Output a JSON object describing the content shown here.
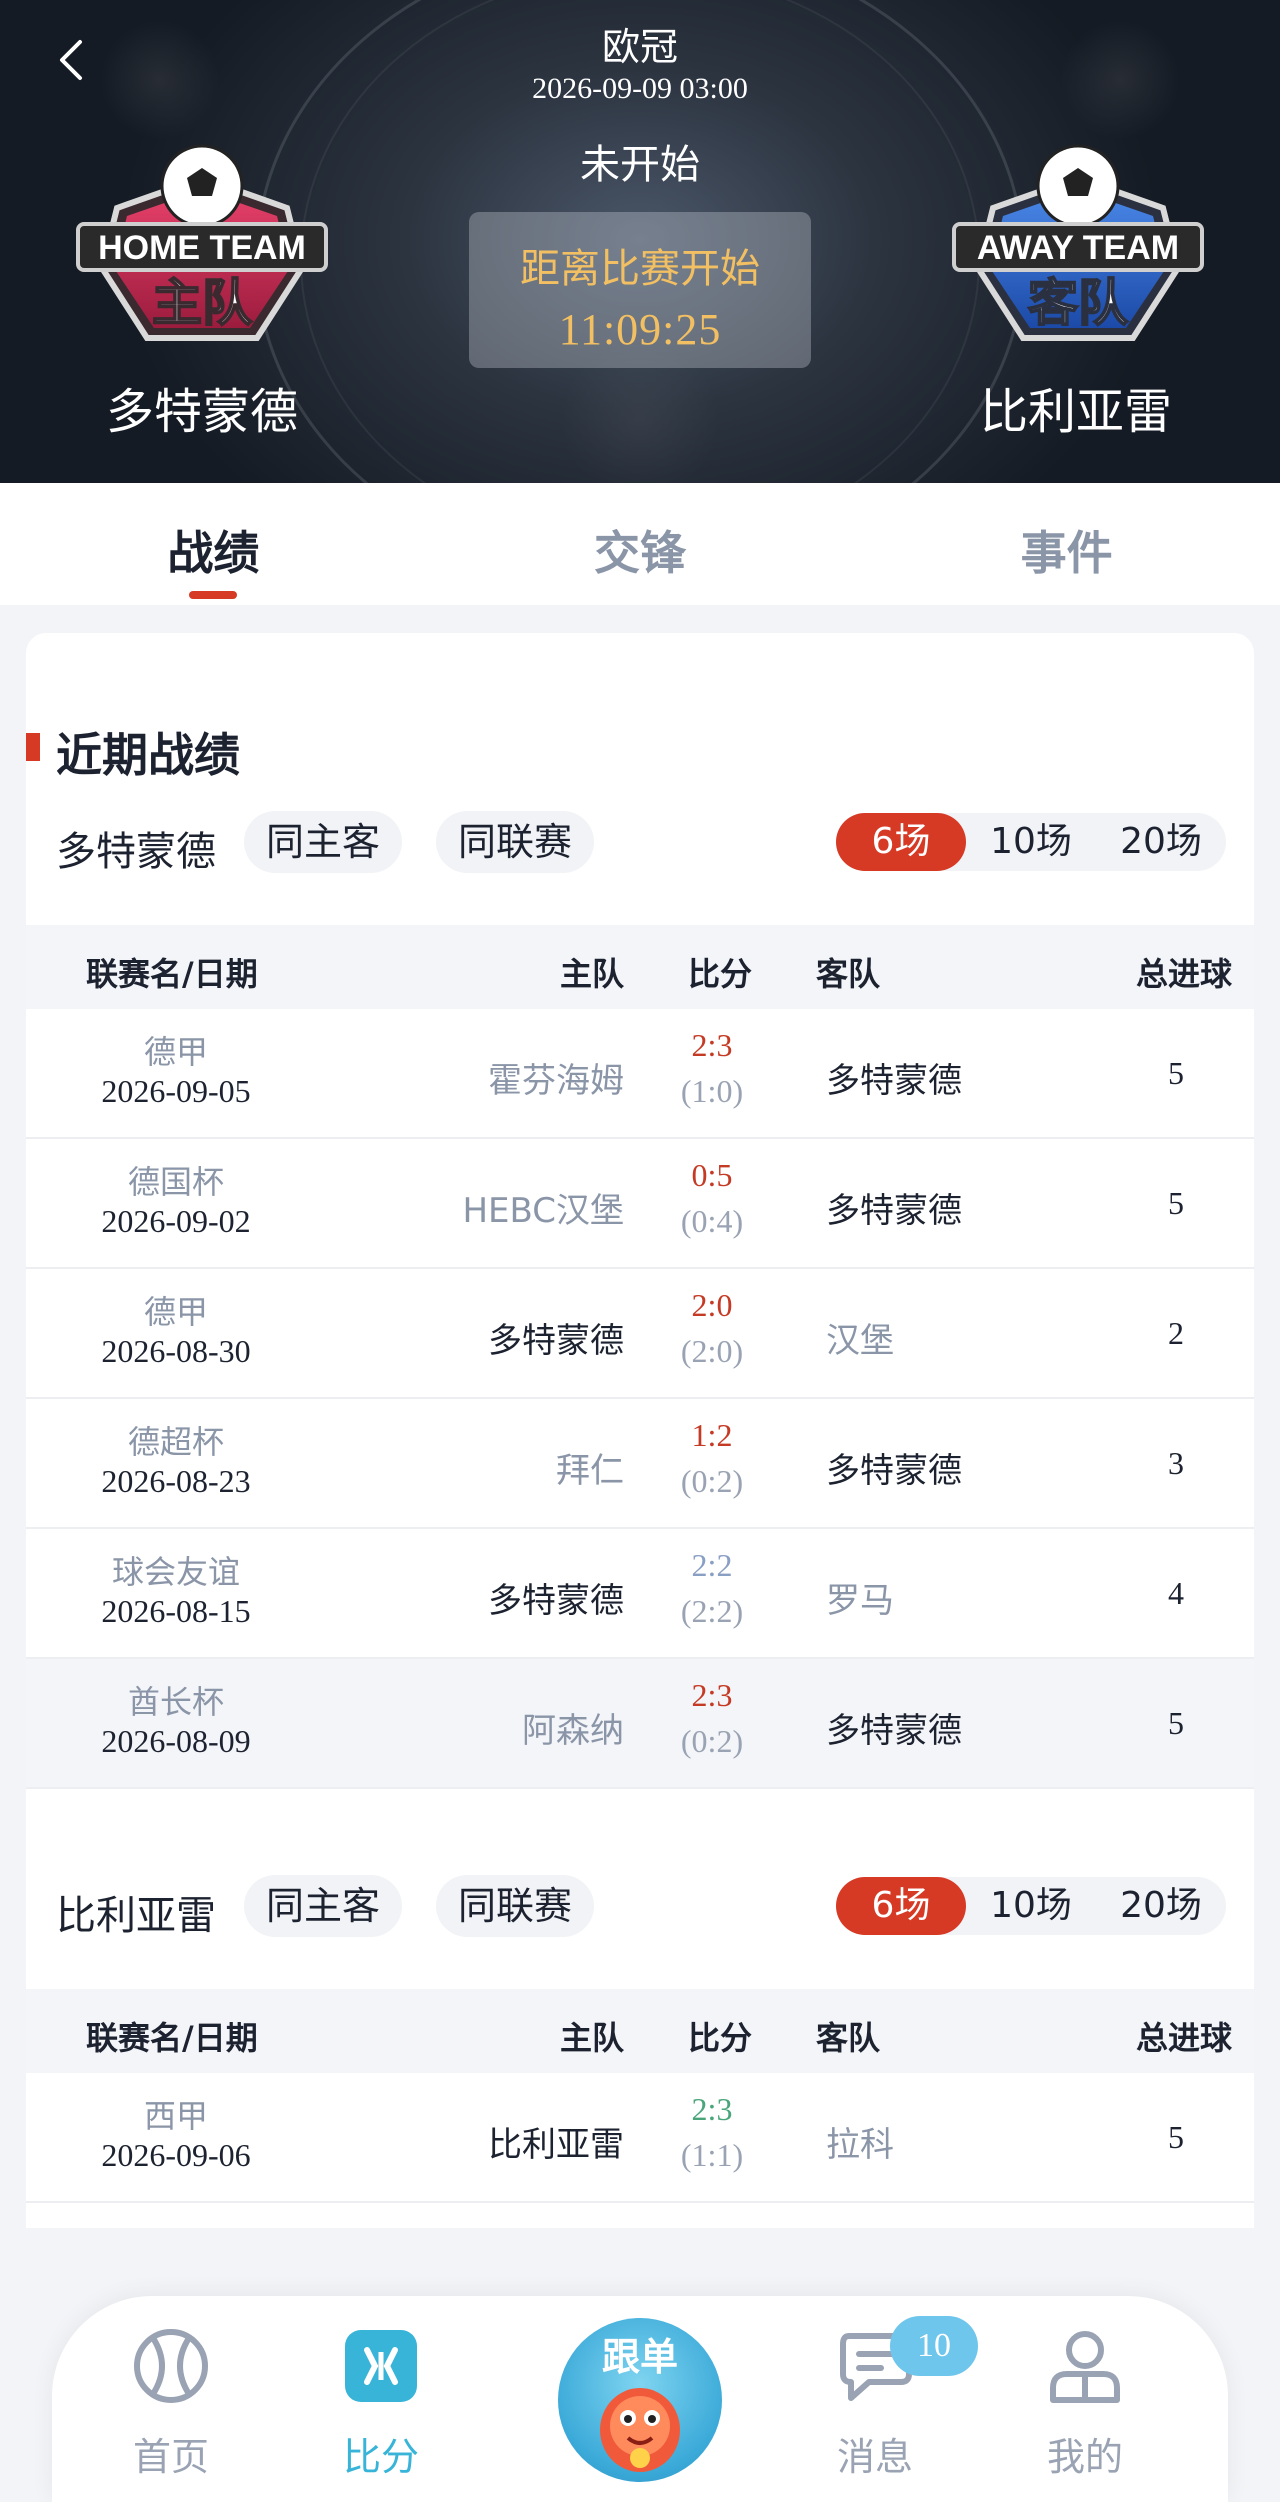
{
  "header": {
    "league": "欧冠",
    "datetime": "2026-09-09 03:00",
    "status": "未开始",
    "countdown_label": "距离比赛开始",
    "countdown_time": "11:09:25",
    "home_team": "多特蒙德",
    "away_team": "比利亚雷",
    "home_logo_text": [
      "HOME TEAM",
      "主队"
    ],
    "away_logo_text": [
      "AWAY TEAM",
      "客队"
    ]
  },
  "tabs": [
    {
      "label": "战绩",
      "active": true
    },
    {
      "label": "交锋",
      "active": false
    },
    {
      "label": "事件",
      "active": false
    }
  ],
  "section": {
    "title": "近期战绩"
  },
  "columns": {
    "league_date": "联赛名/日期",
    "home": "主队",
    "score": "比分",
    "away": "客队",
    "total": "总进球"
  },
  "filters": {
    "same_home_away": "同主客",
    "same_league": "同联赛",
    "counts": [
      "6场",
      "10场",
      "20场"
    ],
    "active_count": "6场"
  },
  "home_block": {
    "team": "多特蒙德",
    "matches": [
      {
        "league": "德甲",
        "date": "2026-09-05",
        "home": "霍芬海姆",
        "score": "2:3",
        "half": "(1:0)",
        "away": "多特蒙德",
        "total": "5",
        "result": "win",
        "focus": "away"
      },
      {
        "league": "德国杯",
        "date": "2026-09-02",
        "home": "HEBC汉堡",
        "score": "0:5",
        "half": "(0:4)",
        "away": "多特蒙德",
        "total": "5",
        "result": "win",
        "focus": "away"
      },
      {
        "league": "德甲",
        "date": "2026-08-30",
        "home": "多特蒙德",
        "score": "2:0",
        "half": "(2:0)",
        "away": "汉堡",
        "total": "2",
        "result": "win",
        "focus": "home"
      },
      {
        "league": "德超杯",
        "date": "2026-08-23",
        "home": "拜仁",
        "score": "1:2",
        "half": "(0:2)",
        "away": "多特蒙德",
        "total": "3",
        "result": "win",
        "focus": "away"
      },
      {
        "league": "球会友谊",
        "date": "2026-08-15",
        "home": "多特蒙德",
        "score": "2:2",
        "half": "(2:2)",
        "away": "罗马",
        "total": "4",
        "result": "draw",
        "focus": "home"
      },
      {
        "league": "酋长杯",
        "date": "2026-08-09",
        "home": "阿森纳",
        "score": "2:3",
        "half": "(0:2)",
        "away": "多特蒙德",
        "total": "5",
        "result": "win",
        "focus": "away"
      }
    ]
  },
  "away_block": {
    "team": "比利亚雷",
    "matches": [
      {
        "league": "西甲",
        "date": "2026-09-06",
        "home": "比利亚雷",
        "score": "2:3",
        "half": "(1:1)",
        "away": "拉科",
        "total": "5",
        "result": "lose",
        "focus": "home"
      }
    ]
  },
  "bottom_nav": {
    "items": [
      {
        "label": "首页",
        "icon": "tennis-ball-icon",
        "active": false
      },
      {
        "label": "比分",
        "icon": "score-icon",
        "active": true
      },
      {
        "label": "跟单",
        "icon": "follow-mascot-icon",
        "active": false
      },
      {
        "label": "消息",
        "icon": "message-icon",
        "active": false
      },
      {
        "label": "我的",
        "icon": "profile-icon",
        "active": false
      }
    ],
    "message_badge": "10"
  },
  "colors": {
    "accent": "#d63a25",
    "nav_active": "#38b4d8",
    "countdown": "#f2c063"
  }
}
